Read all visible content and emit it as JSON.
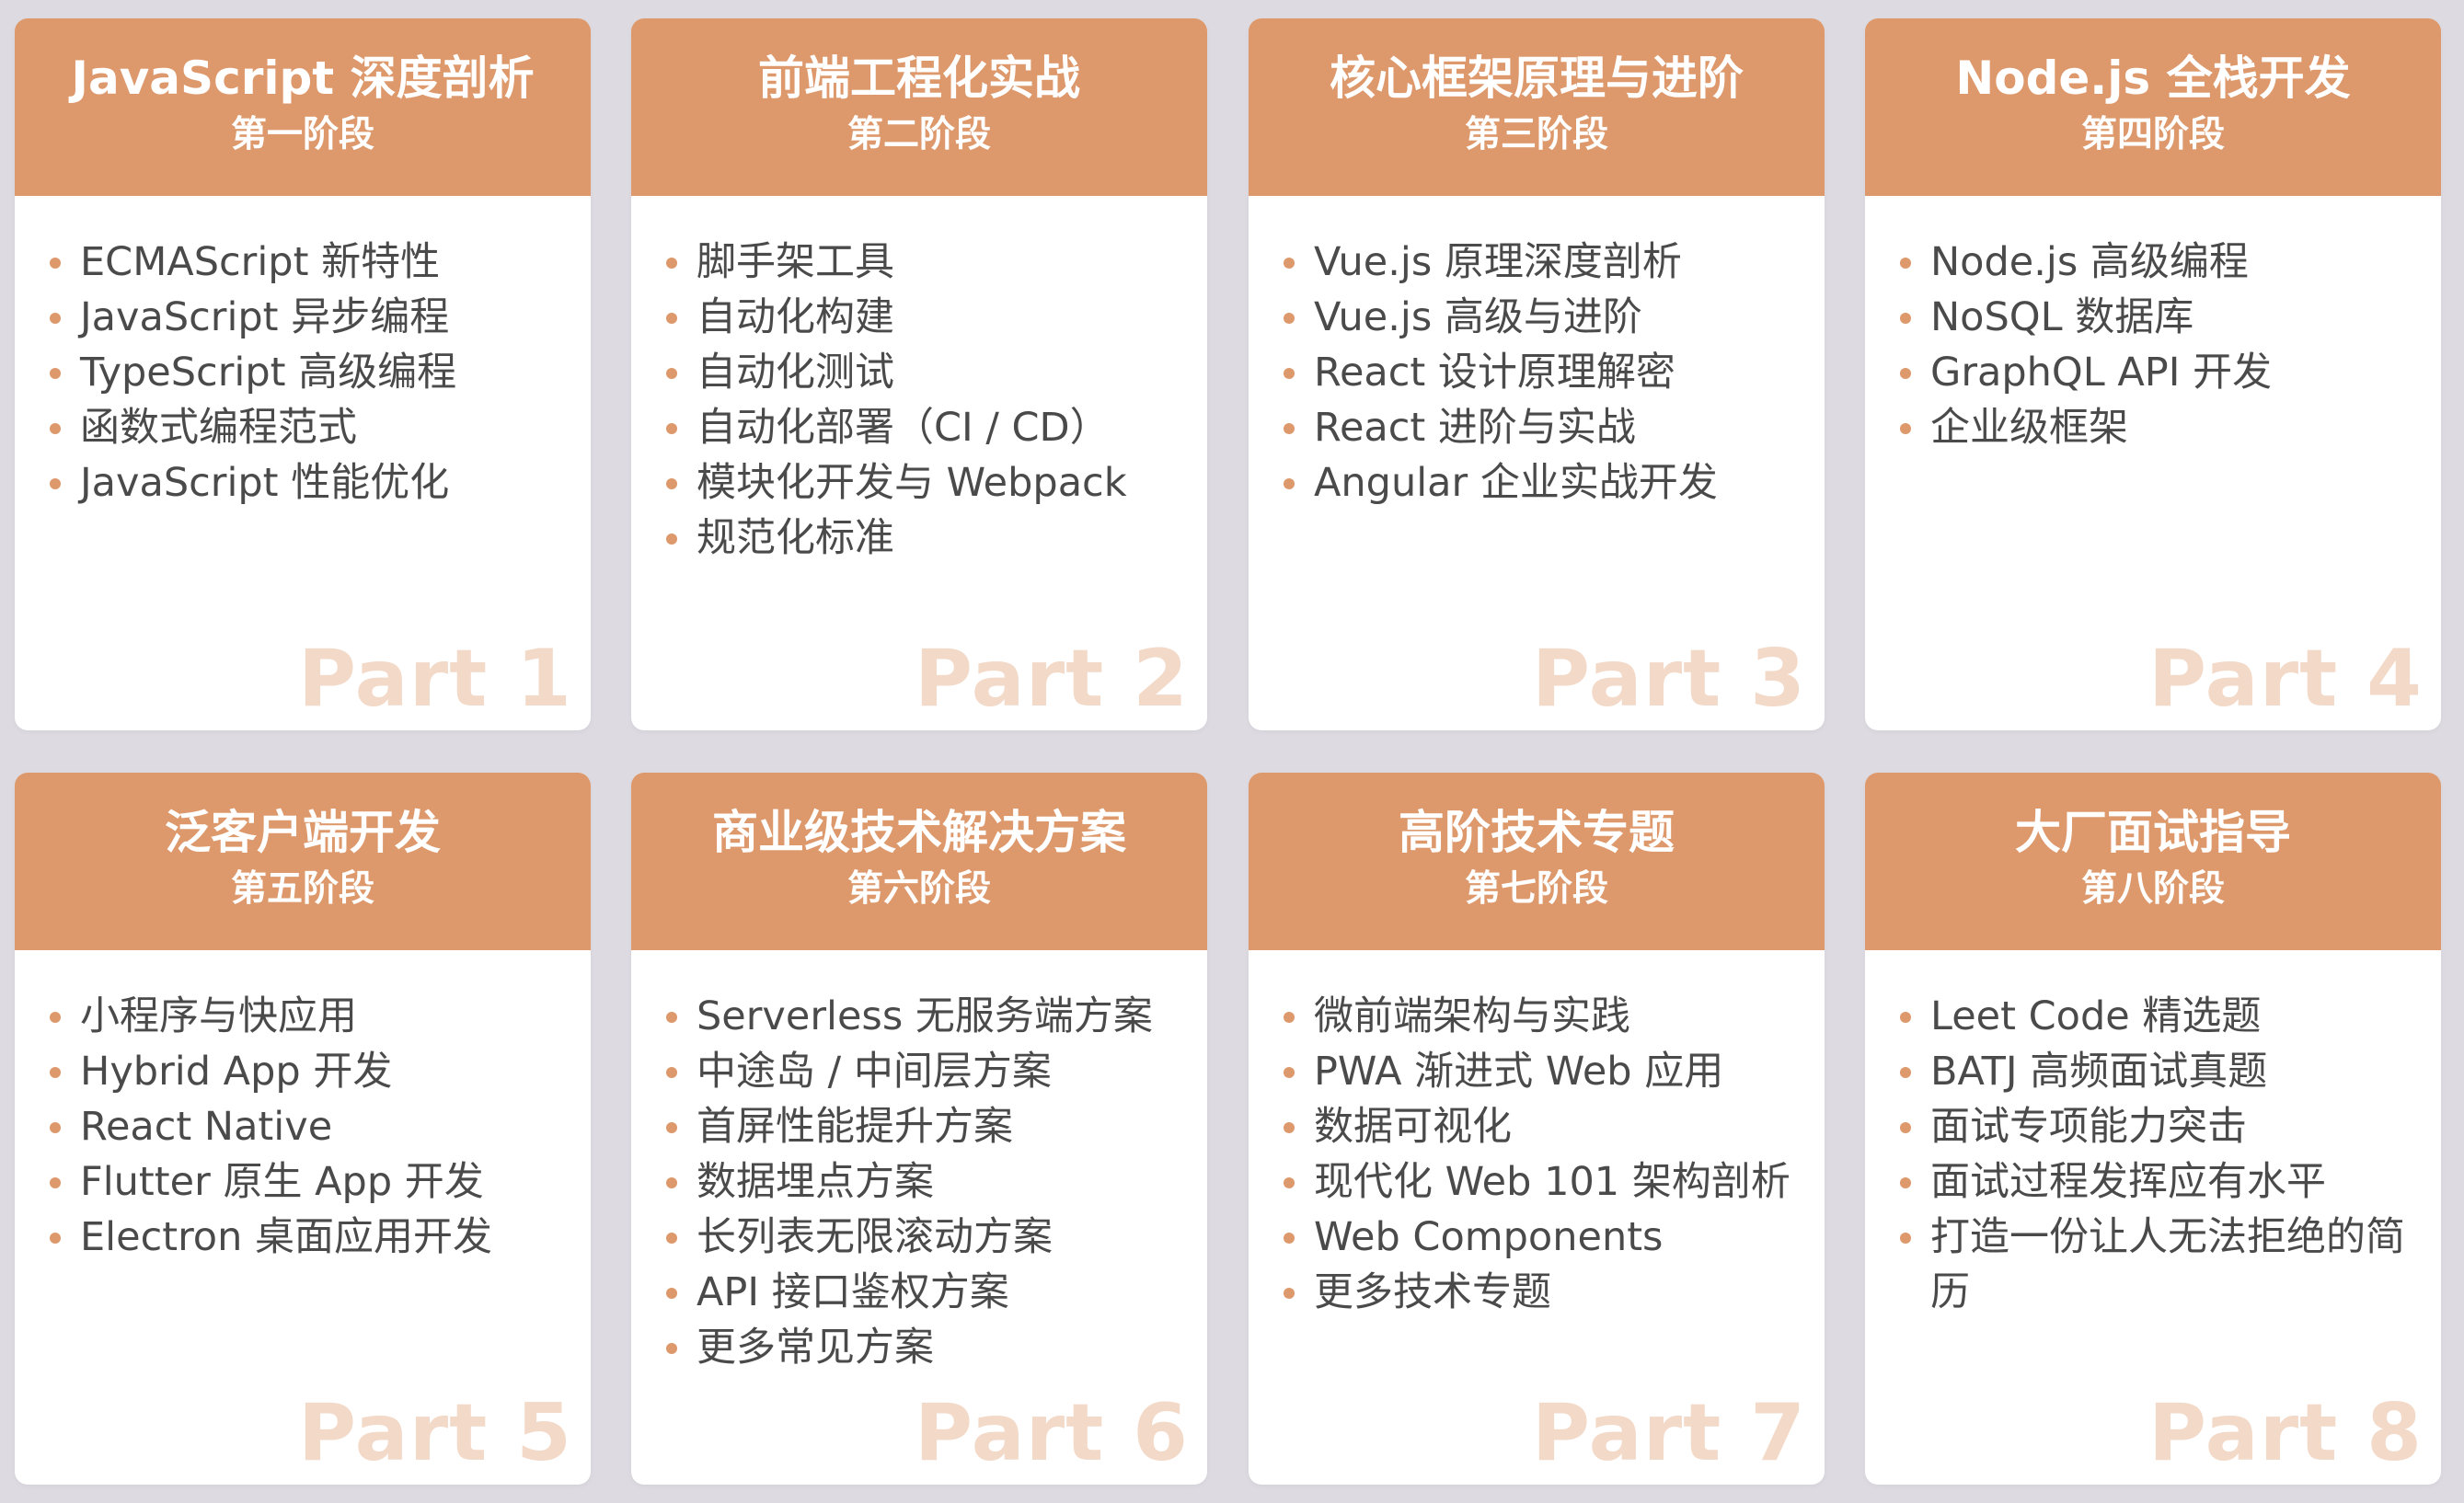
{
  "accent_color": "#dd986b",
  "part_label_color": "#f3d9c8",
  "cards": [
    {
      "title": "JavaScript 深度剖析",
      "stage": "第一阶段",
      "items": [
        "ECMAScript 新特性",
        "JavaScript 异步编程",
        "TypeScript 高级编程",
        "函数式编程范式",
        "JavaScript 性能优化"
      ],
      "part": "Part 1"
    },
    {
      "title": "前端工程化实战",
      "stage": "第二阶段",
      "items": [
        "脚手架工具",
        "自动化构建",
        "自动化测试",
        "自动化部署（CI / CD）",
        "模块化开发与 Webpack",
        "规范化标准"
      ],
      "part": "Part 2"
    },
    {
      "title": "核心框架原理与进阶",
      "stage": "第三阶段",
      "items": [
        "Vue.js 原理深度剖析",
        "Vue.js 高级与进阶",
        "React 设计原理解密",
        "React 进阶与实战",
        "Angular 企业实战开发"
      ],
      "part": "Part 3"
    },
    {
      "title": "Node.js 全栈开发",
      "stage": "第四阶段",
      "items": [
        "Node.js 高级编程",
        "NoSQL 数据库",
        "GraphQL API 开发",
        "企业级框架"
      ],
      "part": "Part 4"
    },
    {
      "title": "泛客户端开发",
      "stage": "第五阶段",
      "items": [
        "小程序与快应用",
        "Hybrid App 开发",
        "React Native",
        "Flutter 原生 App 开发",
        "Electron 桌面应用开发"
      ],
      "part": "Part 5"
    },
    {
      "title": "商业级技术解决方案",
      "stage": "第六阶段",
      "items": [
        "Serverless 无服务端方案",
        "中途岛 / 中间层方案",
        "首屏性能提升方案",
        "数据埋点方案",
        "长列表无限滚动方案",
        "API 接口鉴权方案",
        "更多常见方案"
      ],
      "part": "Part 6"
    },
    {
      "title": "高阶技术专题",
      "stage": "第七阶段",
      "items": [
        "微前端架构与实践",
        "PWA 渐进式 Web 应用",
        "数据可视化",
        "现代化 Web 101 架构剖析",
        "Web Components",
        "更多技术专题"
      ],
      "part": "Part 7"
    },
    {
      "title": "大厂面试指导",
      "stage": "第八阶段",
      "items": [
        "Leet Code 精选题",
        "BATJ 高频面试真题",
        "面试专项能力突击",
        "面试过程发挥应有水平",
        "打造一份让人无法拒绝的简历"
      ],
      "part": "Part 8"
    }
  ]
}
